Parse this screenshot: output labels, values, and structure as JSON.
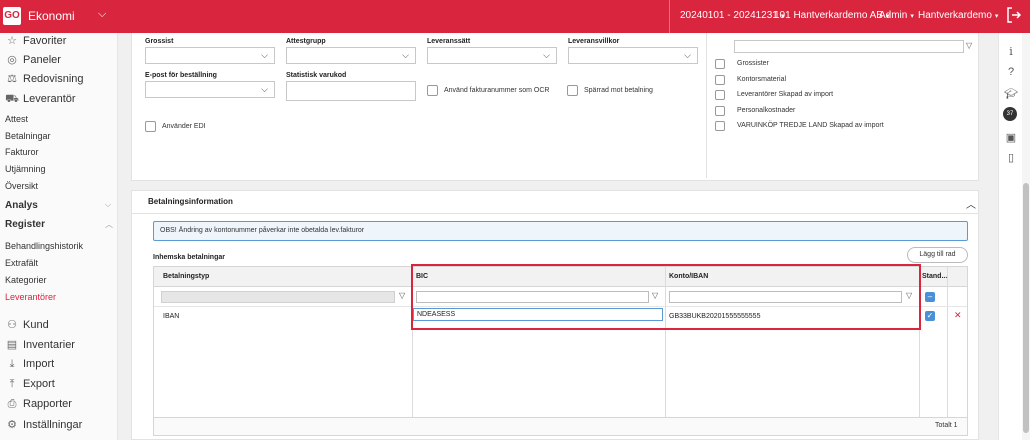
{
  "topbar": {
    "logo": "GO",
    "app": "Ekonomi",
    "period": "20240101 - 20241231",
    "company": "101 Hantverkardemo AB",
    "role": "Admin",
    "user": "Hantverkardemo",
    "color": "#d9253e"
  },
  "sidebar": {
    "favoriter": "Favoriter",
    "paneler": "Paneler",
    "redovisning": "Redovisning",
    "leverantor": "Leverantör",
    "lev_items": [
      "Attest",
      "Betalningar",
      "Fakturor",
      "Utjämning",
      "Översikt"
    ],
    "analys": "Analys",
    "register": "Register",
    "reg_items": [
      "Behandlingshistorik",
      "Extrafält",
      "Kategorier",
      "Leverantörer"
    ],
    "kund": "Kund",
    "inventarier": "Inventarier",
    "import": "Import",
    "export": "Export",
    "rapporter": "Rapporter",
    "installningar": "Inställningar"
  },
  "form": {
    "grossist": "Grossist",
    "attestgrupp": "Attestgrupp",
    "leveranssatt": "Leveranssätt",
    "leveransvillkor": "Leveransvillkor",
    "epost": "E-post för beställning",
    "statistisk": "Statistisk varukod",
    "ocr": "Använd fakturanummer som OCR",
    "sparrad": "Spärrad mot betalning",
    "edi": "Använder EDI"
  },
  "kategorier": [
    "Grossister",
    "Kontorsmaterial",
    "Leverantörer Skapad av import",
    "Personalkostnader",
    "VARUINKÖP TREDJE LAND Skapad av import"
  ],
  "betalning": {
    "title": "Betalningsinformation",
    "notice": "OBS! Ändring av kontonummer påverkar inte obetalda lev.fakturor",
    "subtitle": "Inhemska betalningar",
    "add_button": "Lägg till rad",
    "col_typ": "Betalningstyp",
    "col_bic": "BIC",
    "col_konto": "Konto/IBAN",
    "col_std": "Stand...",
    "row": {
      "typ": "IBAN",
      "bic": "NDEASESS",
      "konto": "GB33BUKB20201555555555"
    },
    "total": "Totalt 1"
  }
}
